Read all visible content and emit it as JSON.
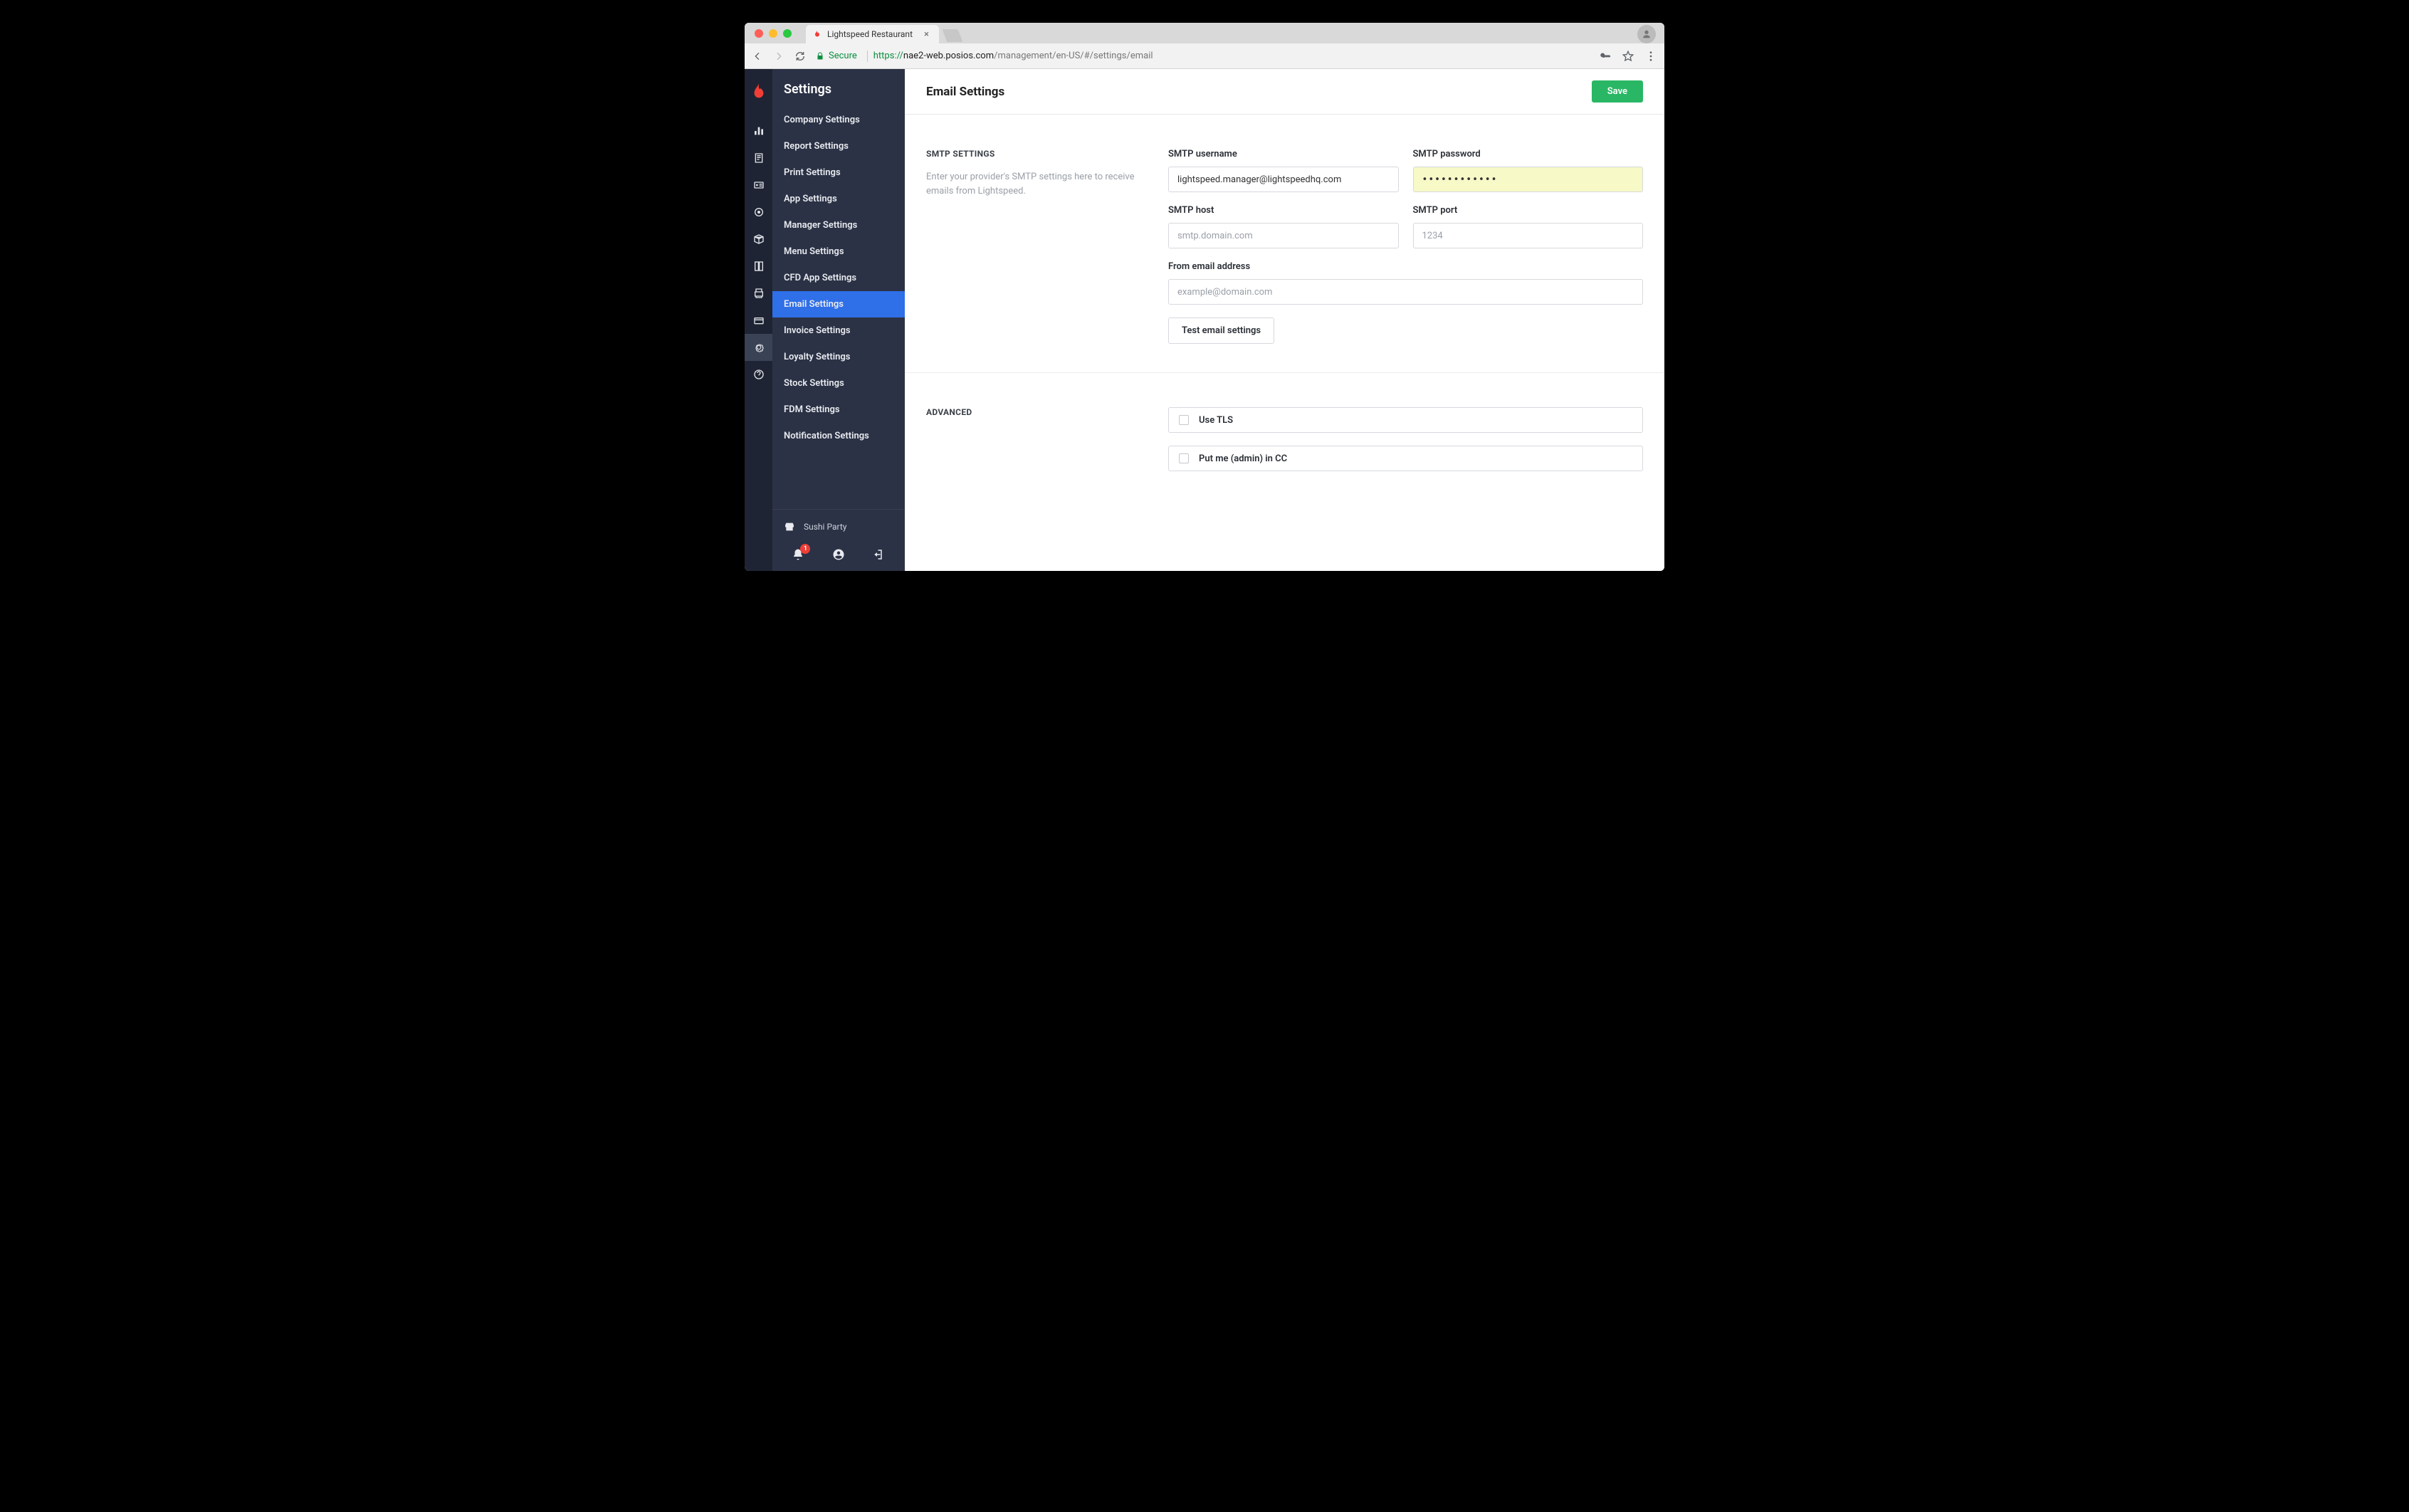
{
  "browser": {
    "tab_title": "Lightspeed Restaurant",
    "secure_label": "Secure",
    "url_protocol": "https://",
    "url_domain": "nae2-web.posios.com",
    "url_path": "/management/en-US/#/settings/email"
  },
  "sidebar": {
    "header": "Settings",
    "items": [
      "Company Settings",
      "Report Settings",
      "Print Settings",
      "App Settings",
      "Manager Settings",
      "Menu Settings",
      "CFD App Settings",
      "Email Settings",
      "Invoice Settings",
      "Loyalty Settings",
      "Stock Settings",
      "FDM Settings",
      "Notification Settings"
    ],
    "selected_index": 7,
    "store_name": "Sushi Party",
    "notif_badge": "1"
  },
  "header": {
    "title": "Email Settings",
    "save_label": "Save"
  },
  "smtp": {
    "section_title": "SMTP SETTINGS",
    "section_desc": "Enter your provider's SMTP settings here to receive emails from Lightspeed.",
    "username_label": "SMTP username",
    "username_value": "lightspeed.manager@lightspeedhq.com",
    "password_label": "SMTP password",
    "password_value": "••••••••••••",
    "host_label": "SMTP host",
    "host_placeholder": "smtp.domain.com",
    "port_label": "SMTP port",
    "port_placeholder": "1234",
    "from_label": "From email address",
    "from_placeholder": "example@domain.com",
    "test_button": "Test email settings"
  },
  "advanced": {
    "section_title": "ADVANCED",
    "use_tls_label": "Use TLS",
    "cc_label": "Put me (admin) in CC"
  }
}
